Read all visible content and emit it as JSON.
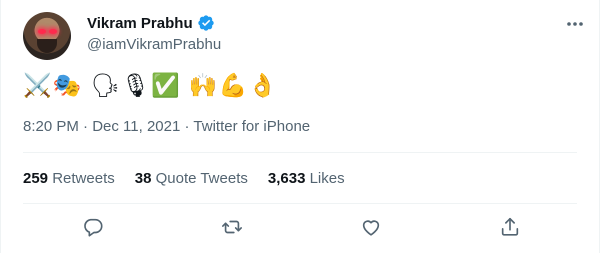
{
  "user": {
    "display_name": "Vikram Prabhu",
    "handle": "@iamVikramPrabhu",
    "verified": true
  },
  "tweet": {
    "text": "⚔️🎭 🗣🎙✅ 🙌💪👌",
    "time": "8:20 PM",
    "date": "Dec 11, 2021",
    "source": "Twitter for iPhone"
  },
  "stats": {
    "retweets_count": "259",
    "retweets_label": "Retweets",
    "quotes_count": "38",
    "quotes_label": "Quote Tweets",
    "likes_count": "3,633",
    "likes_label": "Likes"
  },
  "icons": {
    "verified": "verified-badge-icon",
    "more": "more-icon",
    "reply": "reply-icon",
    "retweet": "retweet-icon",
    "like": "heart-icon",
    "share": "share-icon"
  },
  "colors": {
    "verified": "#1d9bf0",
    "secondary_text": "#536471",
    "primary_text": "#0f1419",
    "divider": "#eff3f4"
  }
}
